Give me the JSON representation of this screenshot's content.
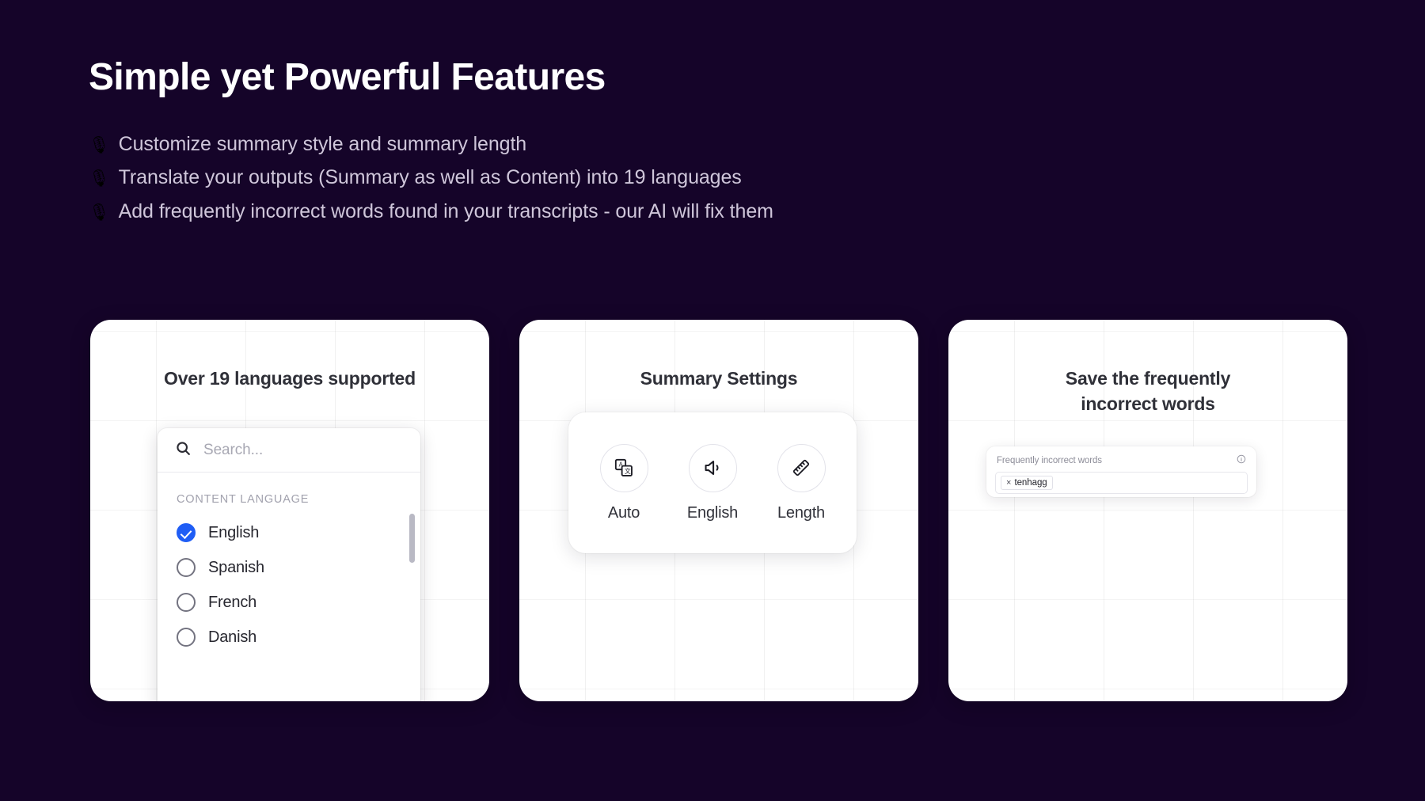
{
  "header": {
    "title": "Simple yet Powerful Features",
    "bullet_icon": "🎙",
    "bullets": [
      "Customize summary style and summary length",
      "Translate your outputs (Summary as well as Content) into 19 languages",
      "Add frequently incorrect words found in your transcripts - our AI will fix them"
    ]
  },
  "colors": {
    "background": "#150429",
    "heading": "#ffffff",
    "body_text": "#cfc6da",
    "card_background": "#ffffff",
    "accent_blue": "#1f5df5",
    "card_title": "#2f3038"
  },
  "cards": [
    {
      "title": "Over 19 languages supported",
      "dropdown": {
        "search_placeholder": "Search...",
        "search_icon": "search-icon",
        "group_label": "CONTENT LANGUAGE",
        "options": [
          {
            "label": "English",
            "selected": true
          },
          {
            "label": "Spanish",
            "selected": false
          },
          {
            "label": "French",
            "selected": false
          },
          {
            "label": "Danish",
            "selected": false
          }
        ]
      }
    },
    {
      "title": "Summary Settings",
      "settings": [
        {
          "label": "Auto",
          "icon": "translate-icon"
        },
        {
          "label": "English",
          "icon": "speaker-icon"
        },
        {
          "label": "Length",
          "icon": "ruler-icon"
        }
      ]
    },
    {
      "title": "Save the frequently incorrect words",
      "field": {
        "label": "Frequently incorrect words",
        "info_icon": "info-icon",
        "chips": [
          {
            "remove": "×",
            "text": "tenhagg"
          }
        ]
      }
    }
  ]
}
